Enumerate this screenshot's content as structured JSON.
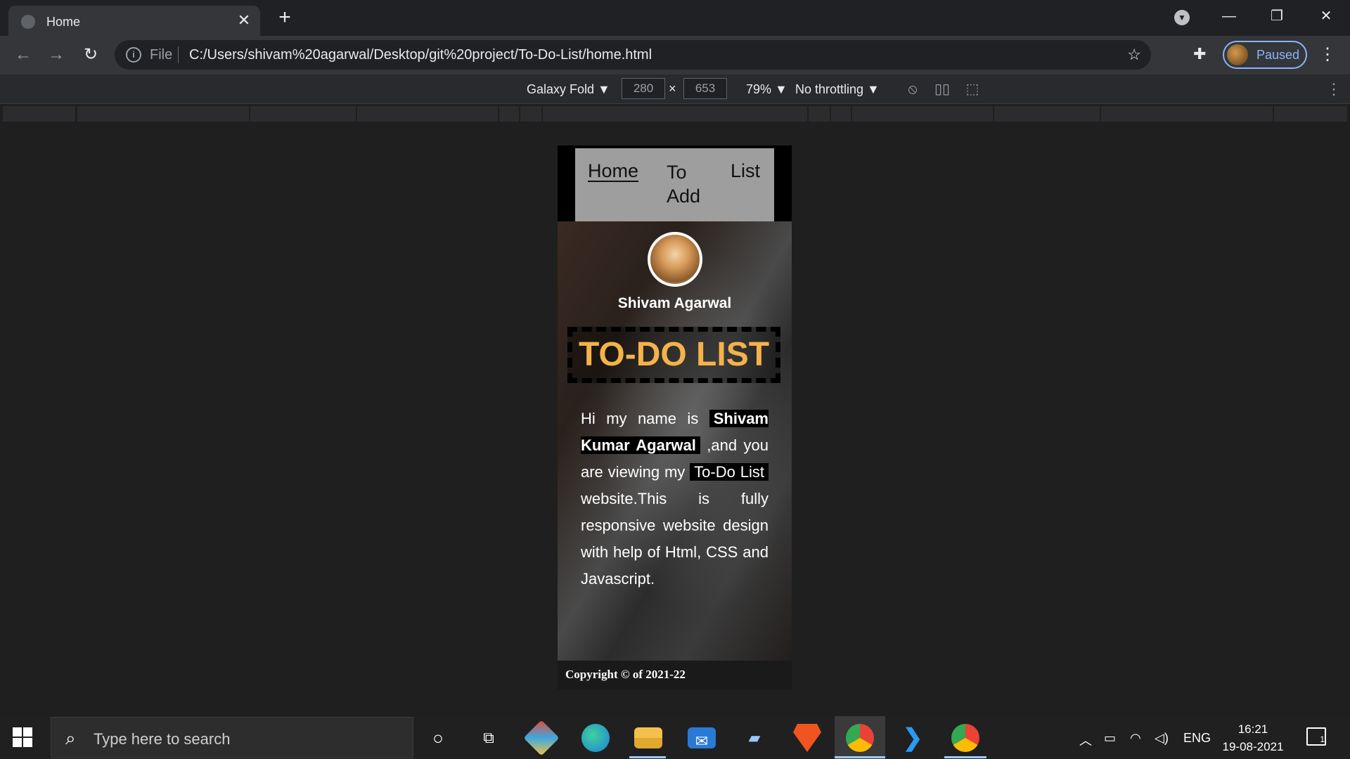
{
  "browser": {
    "tab_title": "Home",
    "tab_close": "✕",
    "new_tab": "+",
    "url_scheme": "File",
    "url": "C:/Users/shivam%20agarwal/Desktop/git%20project/To-Do-List/home.html",
    "profile_label": "Paused",
    "window_controls": {
      "minimize": "—",
      "restore": "❐",
      "close": "✕"
    }
  },
  "devtools": {
    "device": "Galaxy Fold ▼",
    "width": "280",
    "height": "653",
    "times": "×",
    "zoom": "79% ▼",
    "throttling": "No throttling ▼"
  },
  "page": {
    "nav": {
      "home": "Home",
      "to_add": "To Add",
      "list": "List"
    },
    "author": "Shivam Agarwal",
    "title": "TO-DO LIST",
    "intro": {
      "p1": "Hi my name is ",
      "name": "Shivam Kumar Agarwal",
      "p2": " ,and you are viewing my ",
      "site": "To-Do List",
      "p3": " website.This is fully responsive website design with help of Html, CSS and Javascript."
    },
    "footer": "Copyright © of 2021-22"
  },
  "taskbar": {
    "search_placeholder": "Type here to search",
    "language": "ENG",
    "time": "16:21",
    "date": "19-08-2021",
    "notification_count": "1"
  }
}
